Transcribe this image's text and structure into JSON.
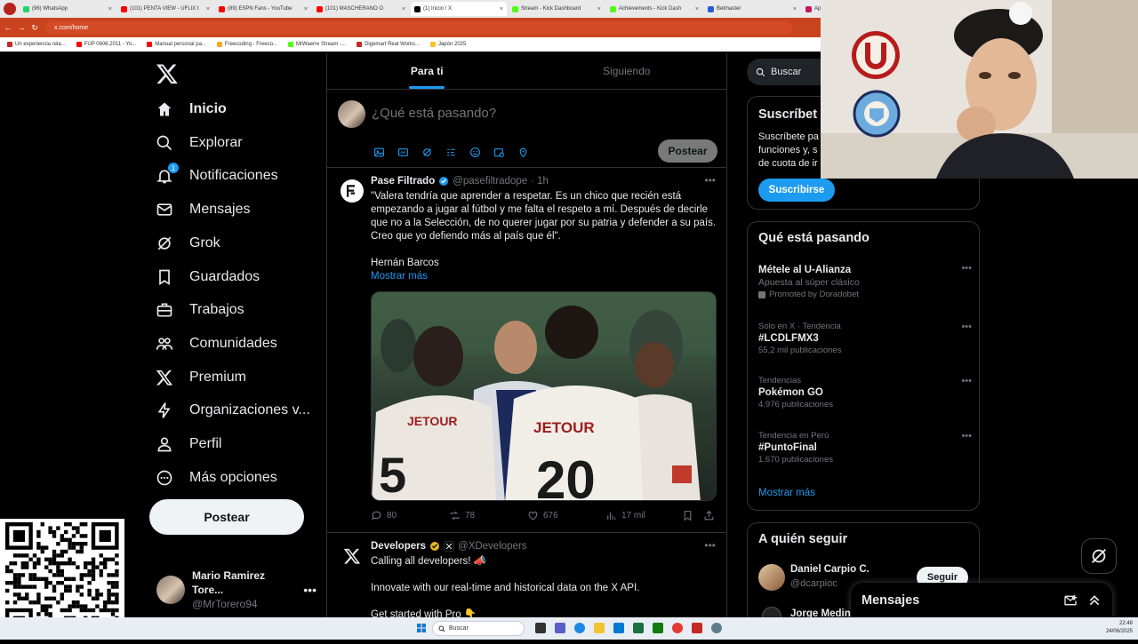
{
  "browser": {
    "tabs": [
      {
        "label": "(96) WhatsApp",
        "color": "#25d366",
        "active": false
      },
      {
        "label": "(101) PENTA VIEW - UFLIX t",
        "color": "#ff0000",
        "active": false
      },
      {
        "label": "(89) ESPN Fans - YouTube",
        "color": "#ff0000",
        "active": false
      },
      {
        "label": "(101) MASCHERANO O",
        "color": "#ff0000",
        "active": false
      },
      {
        "label": "(1) Inicio / X",
        "color": "#000000",
        "active": true
      },
      {
        "label": "Stream - Kick Dashboard",
        "color": "#53fc18",
        "active": false
      },
      {
        "label": "Achievements - Kick Dash",
        "color": "#53fc18",
        "active": false
      },
      {
        "label": "Betmaster",
        "color": "#2a5bd7",
        "active": false
      },
      {
        "label": "Apuestas Deportivas",
        "color": "#c2185b",
        "active": false
      }
    ],
    "url": "x.com/home",
    "bookmarks": [
      {
        "label": "Un experiencia rela...",
        "color": "#c62828"
      },
      {
        "label": "FUP 0606.2011 - Yo...",
        "color": "#ff0000"
      },
      {
        "label": "Manual personal pa...",
        "color": "#ff0000"
      },
      {
        "label": "Freecoding - Freeco...",
        "color": "#f9a825"
      },
      {
        "label": "MrWaerre Stream -...",
        "color": "#53fc18"
      },
      {
        "label": "Digemart Real Works...",
        "color": "#c62828"
      },
      {
        "label": "Japón 2025",
        "color": "#fbc02d"
      }
    ]
  },
  "nav": {
    "items": [
      {
        "label": "Inicio",
        "icon": "home-icon"
      },
      {
        "label": "Explorar",
        "icon": "search-icon"
      },
      {
        "label": "Notificaciones",
        "icon": "bell-icon",
        "badge": "1"
      },
      {
        "label": "Mensajes",
        "icon": "mail-icon"
      },
      {
        "label": "Grok",
        "icon": "grok-icon"
      },
      {
        "label": "Guardados",
        "icon": "bookmark-icon"
      },
      {
        "label": "Trabajos",
        "icon": "briefcase-icon"
      },
      {
        "label": "Comunidades",
        "icon": "people-icon"
      },
      {
        "label": "Premium",
        "icon": "x-icon"
      },
      {
        "label": "Organizaciones v...",
        "icon": "lightning-icon"
      },
      {
        "label": "Perfil",
        "icon": "person-icon"
      },
      {
        "label": "Más opciones",
        "icon": "more-circle-icon"
      }
    ],
    "post_label": "Postear",
    "profile": {
      "name": "Mario Ramirez Tore...",
      "handle": "@MrTorero94"
    }
  },
  "feed": {
    "tabs": [
      "Para ti",
      "Siguiendo"
    ],
    "composer": {
      "placeholder": "¿Qué está pasando?",
      "post_label": "Postear"
    },
    "tweets": [
      {
        "name": "Pase Filtrado",
        "handle": "@pasefiltradope",
        "time": "· 1h",
        "text": "\"Valera tendría que aprender a respetar. Es un chico que recién está empezando a jugar al fútbol y me falta el respeto a mí. Después de decirle que no a la Selección, de no querer jugar por su patria y defender a su país. Creo que yo defiendo más al país que él\".",
        "signature": "Hernán Barcos",
        "show_more": "Mostrar más",
        "replies": "80",
        "reposts": "78",
        "likes": "676",
        "views": "17 mil"
      },
      {
        "name": "Developers",
        "handle": "@XDevelopers",
        "line1": "Calling all developers! 📣",
        "line2": "Innovate with our real-time and historical data on the X API.",
        "line3": "Get started with Pro 👇"
      }
    ]
  },
  "sidebar": {
    "search_label": "Buscar",
    "subscribe": {
      "title": "Suscríbet",
      "text1": "Suscríbete pa",
      "text2": "funciones y, s",
      "text3": "de cuota de ir",
      "button": "Suscribirse"
    },
    "trends": {
      "title": "Qué está pasando",
      "items": [
        {
          "meta": "",
          "title": "Métele al U-Alianza",
          "sub": "Apuesta al súper clásico",
          "promo": "Promoted by Doradobet"
        },
        {
          "meta": "Solo en X · Tendencia",
          "title": "#LCDLFMX3",
          "sub": "55,2 mil publicaciones",
          "promo": ""
        },
        {
          "meta": "Tendencias",
          "title": "Pokémon GO",
          "sub": "4.976 publicaciones",
          "promo": ""
        },
        {
          "meta": "Tendencia en Perú",
          "title": "#PuntoFinal",
          "sub": "1.670 publicaciones",
          "promo": ""
        }
      ],
      "show_more": "Mostrar más"
    },
    "who_to_follow": {
      "title": "A quién seguir",
      "users": [
        {
          "name": "Daniel Carpio C.",
          "handle": "@dcarpioc",
          "button": "Seguir"
        },
        {
          "name": "Jorge Medina",
          "handle": "",
          "button": ""
        }
      ]
    }
  },
  "messages_drawer": {
    "title": "Mensajes"
  },
  "taskbar": {
    "search": "Buscar",
    "time": "22:48",
    "date": "24/06/2025"
  }
}
